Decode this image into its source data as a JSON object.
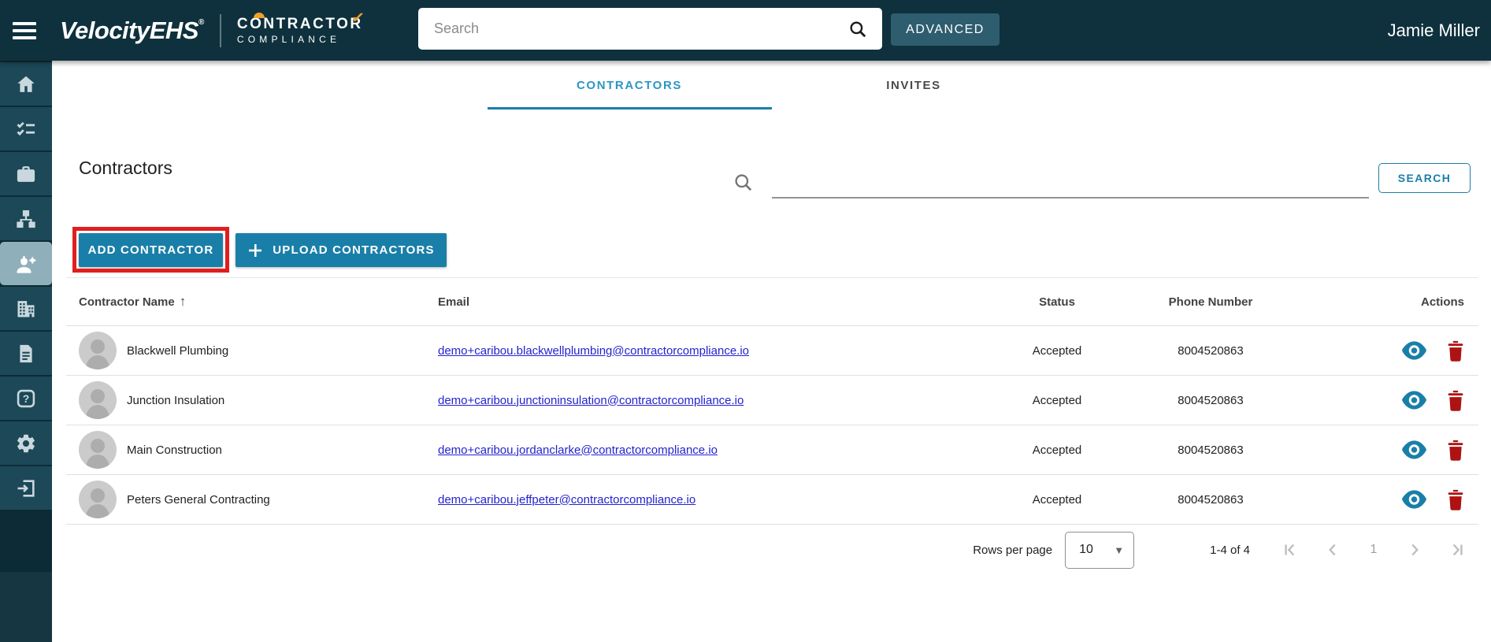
{
  "header": {
    "brand": "VelocityEHS",
    "brand_reg": "®",
    "product_line1": "CONTRACTOR",
    "product_line2": "COMPLIANCE",
    "search_placeholder": "Search",
    "advanced_label": "ADVANCED",
    "user_name": "Jamie Miller"
  },
  "sidebar": {
    "items": [
      {
        "name": "home",
        "icon": "home-icon",
        "active": false
      },
      {
        "name": "tasks",
        "icon": "checklist-icon",
        "active": false
      },
      {
        "name": "jobs",
        "icon": "briefcase-icon",
        "active": false
      },
      {
        "name": "org-chart",
        "icon": "sitemap-icon",
        "active": false
      },
      {
        "name": "contractors",
        "icon": "contractor-worker-icon",
        "active": true
      },
      {
        "name": "company",
        "icon": "building-icon",
        "active": false
      },
      {
        "name": "documents",
        "icon": "document-icon",
        "active": false
      },
      {
        "name": "help",
        "icon": "help-icon",
        "active": false
      },
      {
        "name": "settings",
        "icon": "gear-icon",
        "active": false
      },
      {
        "name": "logout",
        "icon": "exit-icon",
        "active": false
      }
    ]
  },
  "tabs": [
    {
      "label": "CONTRACTORS",
      "active": true
    },
    {
      "label": "INVITES",
      "active": false
    }
  ],
  "page": {
    "title": "Contractors",
    "search_button_label": "SEARCH",
    "add_button_label": "ADD CONTRACTOR",
    "upload_button_label": "UPLOAD CONTRACTORS"
  },
  "table": {
    "columns": [
      "Contractor Name",
      "Email",
      "Status",
      "Phone Number",
      "Actions"
    ],
    "sort": {
      "column": "Contractor Name",
      "direction": "ascending",
      "glyph": "↑"
    },
    "rows": [
      {
        "name": "Blackwell Plumbing",
        "email": "demo+caribou.blackwellplumbing@contractorcompliance.io",
        "status": "Accepted",
        "phone": "8004520863"
      },
      {
        "name": "Junction Insulation",
        "email": "demo+caribou.junctioninsulation@contractorcompliance.io",
        "status": "Accepted",
        "phone": "8004520863"
      },
      {
        "name": "Main Construction",
        "email": "demo+caribou.jordanclarke@contractorcompliance.io",
        "status": "Accepted",
        "phone": "8004520863"
      },
      {
        "name": "Peters General Contracting",
        "email": "demo+caribou.jeffpeter@contractorcompliance.io",
        "status": "Accepted",
        "phone": "8004520863"
      }
    ]
  },
  "pagination": {
    "rows_per_page_label": "Rows per page",
    "rows_per_page_value": "10",
    "range_label": "1-4 of 4",
    "current_page": "1"
  },
  "colors": {
    "header_bg": "#0E313D",
    "sidebar_tile": "#1C4857",
    "sidebar_active_tile": "#8FAFBA",
    "accent_teal": "#1A7FA8",
    "tab_active_text": "#2C96C3",
    "annotation_red": "#E11E1E",
    "link_blue": "#2323CF",
    "eye_icon": "#1A7FA8",
    "trash_icon": "#AE1212",
    "logo_orange": "#F0A028"
  }
}
